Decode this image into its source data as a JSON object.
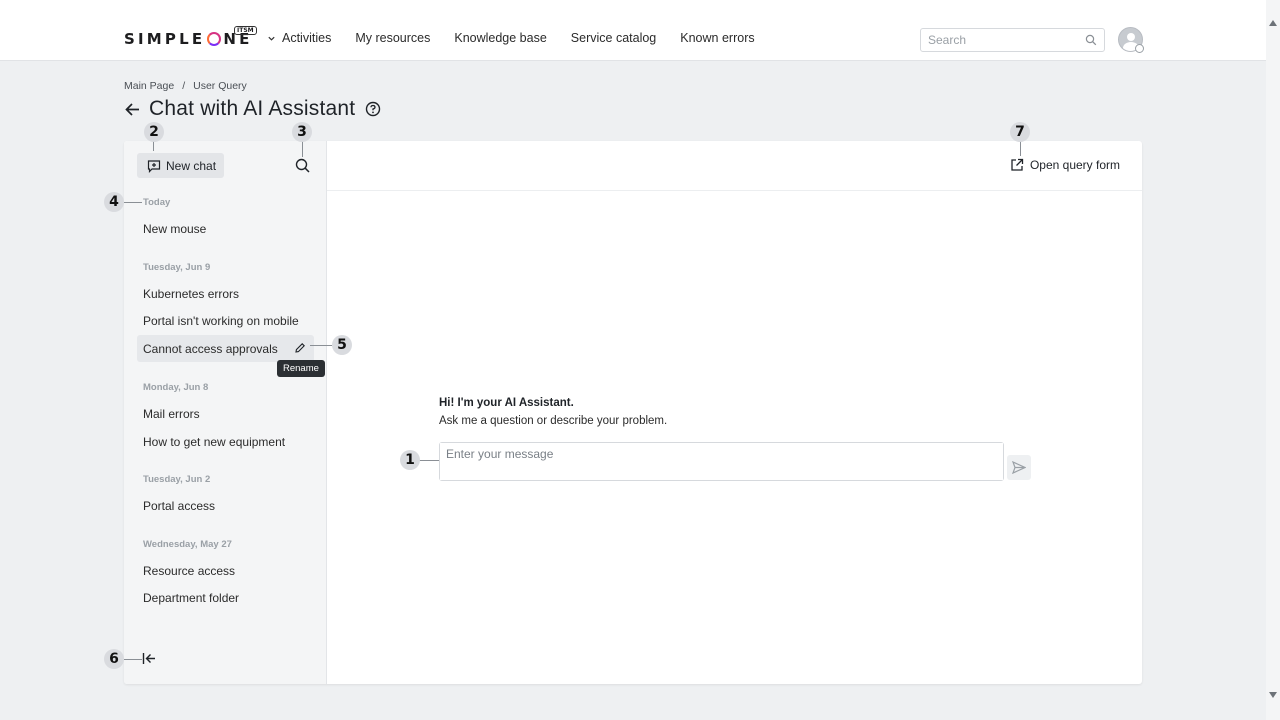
{
  "header": {
    "logo_text": "SIMPLEONE",
    "logo_badge": "ITSM",
    "nav_items": [
      "Activities",
      "My resources",
      "Knowledge base",
      "Service catalog",
      "Known errors"
    ],
    "search_placeholder": "Search",
    "avatar_icon": "user-avatar-icon"
  },
  "breadcrumb": [
    "Main Page",
    "User Query"
  ],
  "page_title": "Chat with AI Assistant",
  "sidebar": {
    "new_chat_label": "New chat",
    "groups": [
      {
        "label": "Today",
        "items": [
          "New mouse"
        ]
      },
      {
        "label": "Tuesday, Jun 9",
        "items": [
          "Kubernetes errors",
          "Portal isn't working on mobile",
          "Cannot access approvals"
        ]
      },
      {
        "label": "Monday, Jun 8",
        "items": [
          "Mail errors",
          "How to get new equipment"
        ]
      },
      {
        "label": "Tuesday, Jun 2",
        "items": [
          "Portal access"
        ]
      },
      {
        "label": "Wednesday, May 27",
        "items": [
          "Resource access",
          "Department folder"
        ]
      }
    ],
    "tooltip": "Rename"
  },
  "main": {
    "open_form_label": "Open query form",
    "greeting_title": "Hi! I'm your AI Assistant.",
    "greeting_text": "Ask me a question or describe your problem.",
    "message_placeholder": "Enter your message"
  },
  "callouts": [
    "1",
    "2",
    "3",
    "4",
    "5",
    "6",
    "7"
  ],
  "colors": {
    "accent_logo": "#d63384",
    "background": "#eef0f2"
  }
}
